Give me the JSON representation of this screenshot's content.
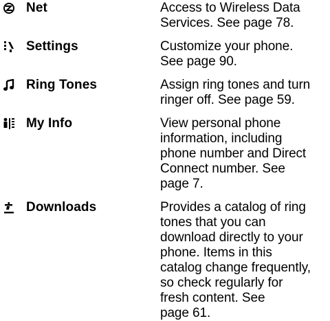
{
  "menu": {
    "items": [
      {
        "icon": "net-icon",
        "name": "Net",
        "description_lines": [
          "Access to Wireless Data",
          "Services. See page 78."
        ]
      },
      {
        "icon": "settings-icon",
        "name": "Settings",
        "description_lines": [
          "Customize your phone.",
          "See page 90."
        ]
      },
      {
        "icon": "ring-tones-icon",
        "name": "Ring Tones",
        "description_lines": [
          "Assign ring tones and turn",
          "ringer off. See page 59."
        ]
      },
      {
        "icon": "my-info-icon",
        "name": "My Info",
        "description_lines": [
          "View personal phone",
          "information, including",
          "phone number and Direct",
          "Connect number. See",
          "page 7."
        ]
      },
      {
        "icon": "downloads-icon",
        "name": "Downloads",
        "description_lines": [
          "Provides a catalog of ring",
          "tones that you can",
          "download directly to your",
          "phone. Items in this",
          "catalog change frequently,",
          "so check regularly for",
          "fresh content. See",
          "page 61."
        ]
      }
    ]
  }
}
